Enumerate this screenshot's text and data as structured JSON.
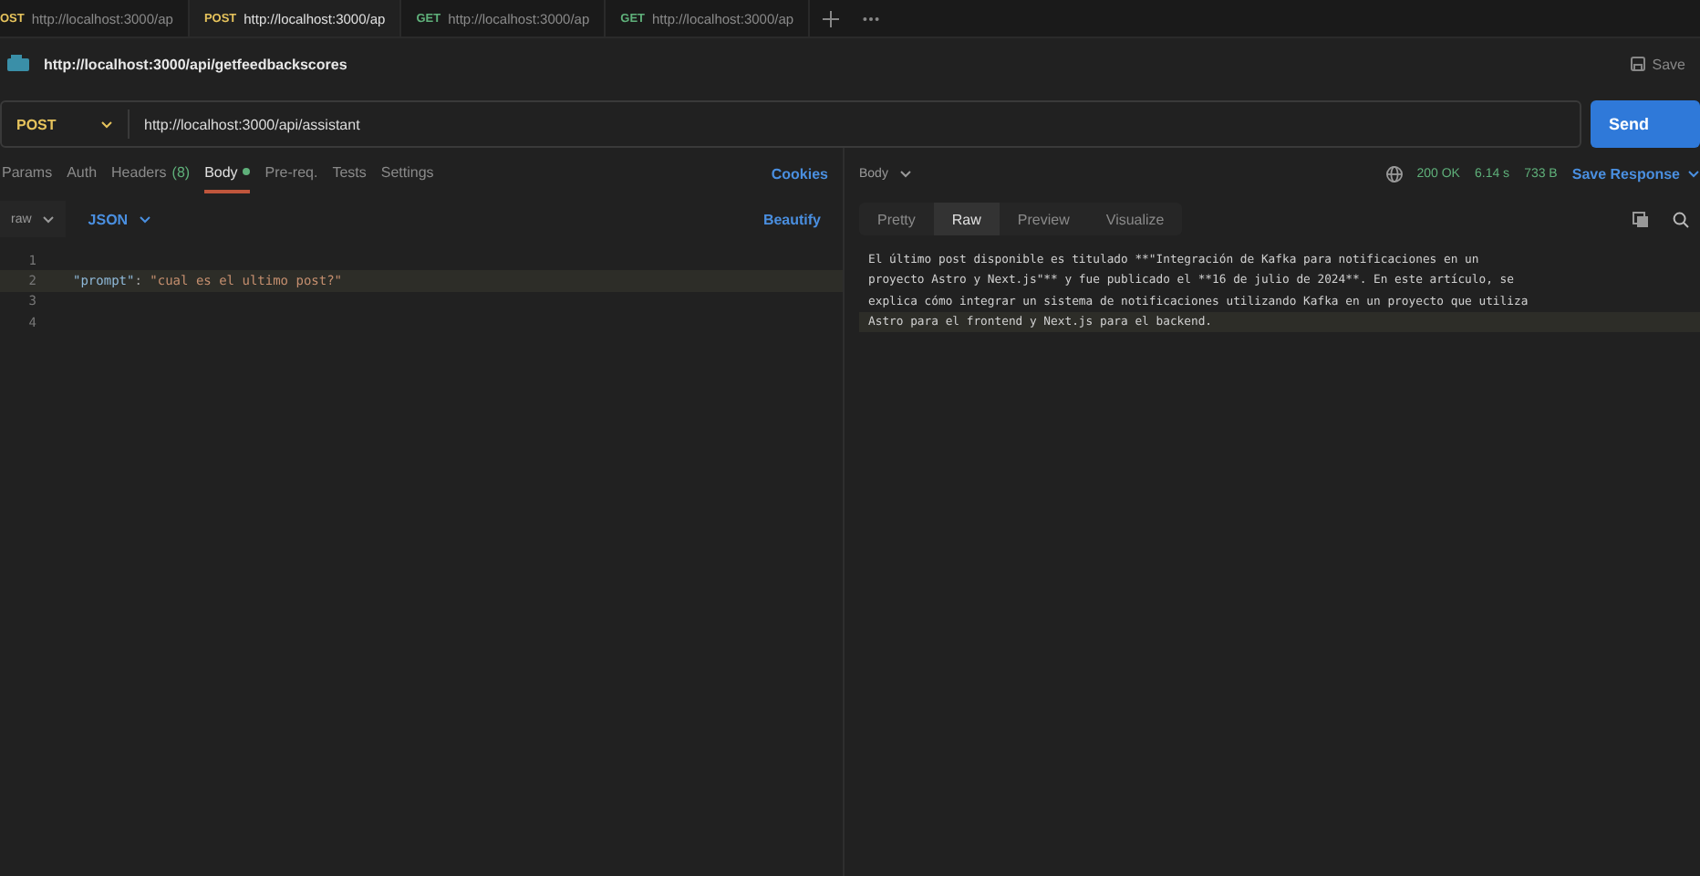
{
  "tabs": [
    {
      "method": "OST",
      "url": "http://localhost:3000/ap",
      "selected": false,
      "kind": "post"
    },
    {
      "method": "POST",
      "url": "http://localhost:3000/ap",
      "selected": true,
      "kind": "post"
    },
    {
      "method": "GET",
      "url": "http://localhost:3000/ap",
      "selected": false,
      "kind": "get"
    },
    {
      "method": "GET",
      "url": "http://localhost:3000/ap",
      "selected": false,
      "kind": "get"
    }
  ],
  "request_title": "http://localhost:3000/api/getfeedbackscores",
  "save_label": "Save",
  "url_bar": {
    "method": "POST",
    "url": "http://localhost:3000/api/assistant",
    "send_label": "Send"
  },
  "request_tabs": [
    {
      "label": "Params",
      "selected": false
    },
    {
      "label": "Auth",
      "selected": false
    },
    {
      "label": "Headers",
      "count": "(8)",
      "selected": false
    },
    {
      "label": "Body",
      "selected": true,
      "dot": true
    },
    {
      "label": "Pre-req.",
      "selected": false
    },
    {
      "label": "Tests",
      "selected": false
    },
    {
      "label": "Settings",
      "selected": false
    }
  ],
  "cookies_label": "Cookies",
  "body_mode": "raw",
  "body_format": "JSON",
  "beautify_label": "Beautify",
  "editor": {
    "lines": [
      {
        "number": "1"
      },
      {
        "number": "2",
        "key": "\"prompt\"",
        "separator": ":",
        "value": "\"cual es el ultimo post?\""
      },
      {
        "number": "3"
      },
      {
        "number": "4"
      }
    ]
  },
  "response": {
    "body_label": "Body",
    "status": "200 OK",
    "time": "6.14 s",
    "size": "733 B",
    "save_response": "Save Response",
    "view_tabs": [
      {
        "label": "Pretty",
        "selected": false
      },
      {
        "label": "Raw",
        "selected": true
      },
      {
        "label": "Preview",
        "selected": false
      },
      {
        "label": "Visualize",
        "selected": false
      }
    ],
    "lines": [
      "El último post disponible es titulado **\"Integración de Kafka para notificaciones en un",
      "proyecto Astro y Next.js\"** y fue publicado el **16 de julio de 2024**. En este artículo, se",
      "explica cómo integrar un sistema de notificaciones utilizando Kafka en un proyecto que utiliza",
      "Astro para el frontend y Next.js para el backend."
    ]
  }
}
